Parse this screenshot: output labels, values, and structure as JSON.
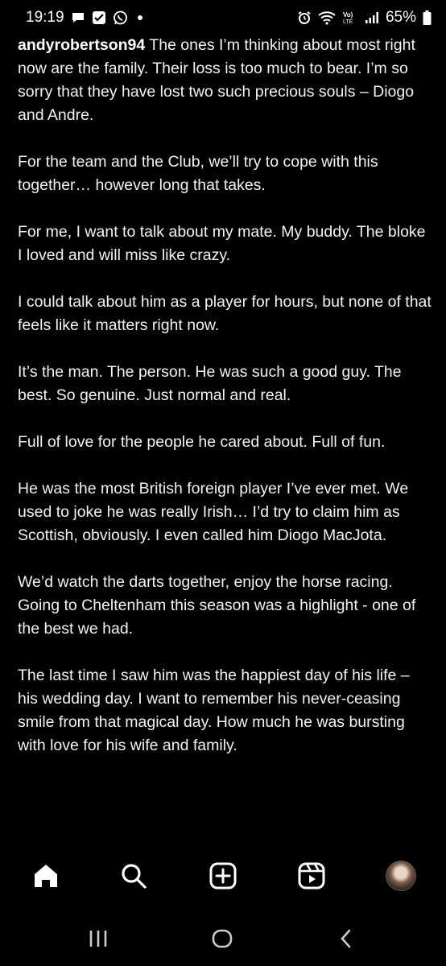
{
  "status_bar": {
    "time": "19:19",
    "battery": "65%",
    "icons_left": [
      "chat-icon",
      "check-box-icon",
      "whatsapp-icon"
    ],
    "icons_right": [
      "alarm-icon",
      "wifi-icon",
      "volte-icon",
      "signal-icon",
      "battery-icon"
    ]
  },
  "post": {
    "username": "andyrobertson94",
    "paragraphs": [
      " The ones I’m thinking about most right now are the family. Their loss is too much to bear. I’m so sorry that they have lost two such precious souls – Diogo and Andre.",
      "For the team and the Club, we’ll try to cope with this together… however long that takes.",
      "For me, I want to talk about my mate. My buddy. The bloke I loved and will miss like crazy.",
      "I could talk about him as a player for hours, but none of that feels like it matters right now.",
      "It’s the man. The person. He was such a good guy. The best. So genuine. Just normal and real.",
      "Full of love for the people he cared about. Full of fun.",
      "He was the most British foreign player I’ve ever met. We used to joke he was really Irish… I’d try to claim him as Scottish, obviously. I even called him Diogo MacJota.",
      "We’d watch the darts together, enjoy the horse racing. Going to Cheltenham this season was a highlight - one of the best we had.",
      "The last time I saw him was the happiest day of his life – his wedding day. I want to remember his never-ceasing smile from that magical day. How much he was bursting with love for his wife and family."
    ]
  },
  "bottom_nav": [
    "home-icon",
    "search-icon",
    "create-icon",
    "reels-icon",
    "profile-avatar"
  ],
  "system_nav": [
    "recent-apps-icon",
    "home-circle-icon",
    "back-icon"
  ]
}
